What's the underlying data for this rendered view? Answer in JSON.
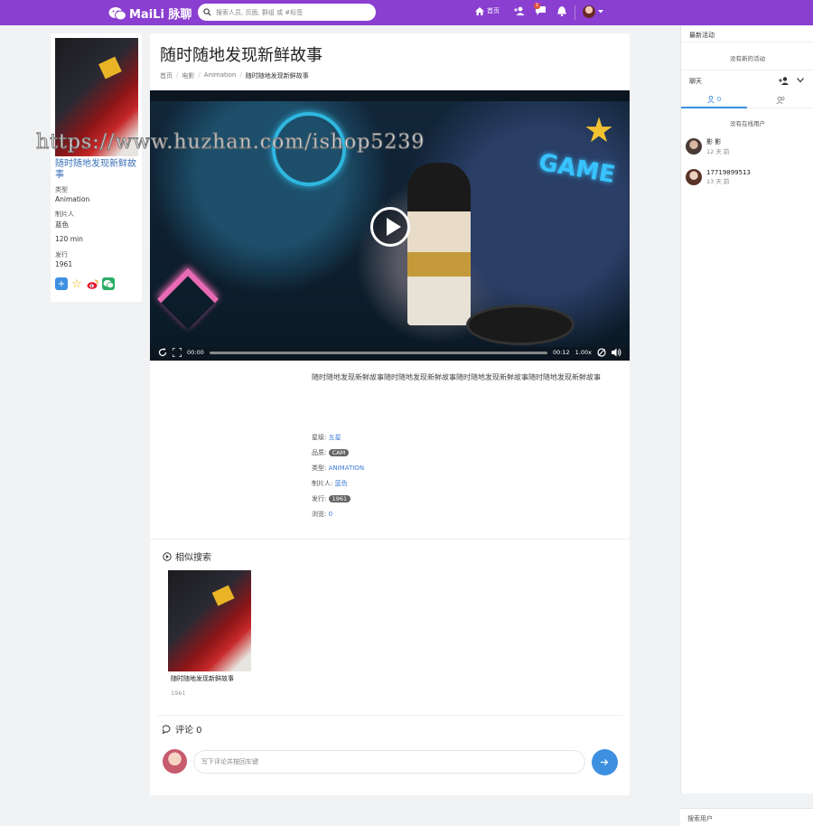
{
  "topbar": {
    "brand": "MaiLi 脉聊",
    "search_placeholder": "搜索人员, 页面, 群组 或 #标签",
    "home_label": "首页",
    "messages_badge": "1",
    "bg_color": "#8a3fd0"
  },
  "left_card": {
    "title": "随时随地发现新鲜故事",
    "type_label": "类型",
    "type_value": "Animation",
    "producer_label": "制片人",
    "producer_value": "蓝色",
    "duration": "120 min",
    "release_label": "发行",
    "release_value": "1961",
    "share_icons": [
      "plus-share-icon",
      "star-share-icon",
      "weibo-icon",
      "wechat-icon"
    ]
  },
  "watermark": "https://www.huzhan.com/ishop5239",
  "main": {
    "title": "随时随地发现新鲜故事",
    "breadcrumb": [
      "首页",
      "电影",
      "Animation",
      "随时随地发现新鲜故事"
    ],
    "video": {
      "current_time": "00:00",
      "duration": "00:12",
      "speed": "1.00x"
    },
    "description": "随时随地发现新鲜故事随时随地发现新鲜故事随时随地发现新鲜故事随时随地发现新鲜故事",
    "meta": {
      "rating_label": "星级:",
      "rating_value": "五星",
      "quality_label": "品质:",
      "quality_value": "CAM",
      "type_label": "类型:",
      "type_value": "ANIMATION",
      "producer_label": "制片人:",
      "producer_value": "蓝色",
      "release_label": "发行:",
      "release_value": "1961",
      "views_label": "浏览:",
      "views_value": "0"
    },
    "related_title": "相似搜索",
    "related_items": [
      {
        "title": "随时随地发现新鲜故事",
        "year": "1961"
      }
    ],
    "comments_title": "评论 0",
    "comment_placeholder": "写下评论并按回车键"
  },
  "right_panel": {
    "activity_title": "最新活动",
    "no_activity": "没有新的活动",
    "chat_title": "聊天",
    "online_count": "0",
    "no_online": "没有在线用户",
    "users": [
      {
        "name": "影 影",
        "time": "12 天 前"
      },
      {
        "name": "17719899513",
        "time": "13 天 前"
      }
    ],
    "search_users": "搜索用户"
  }
}
